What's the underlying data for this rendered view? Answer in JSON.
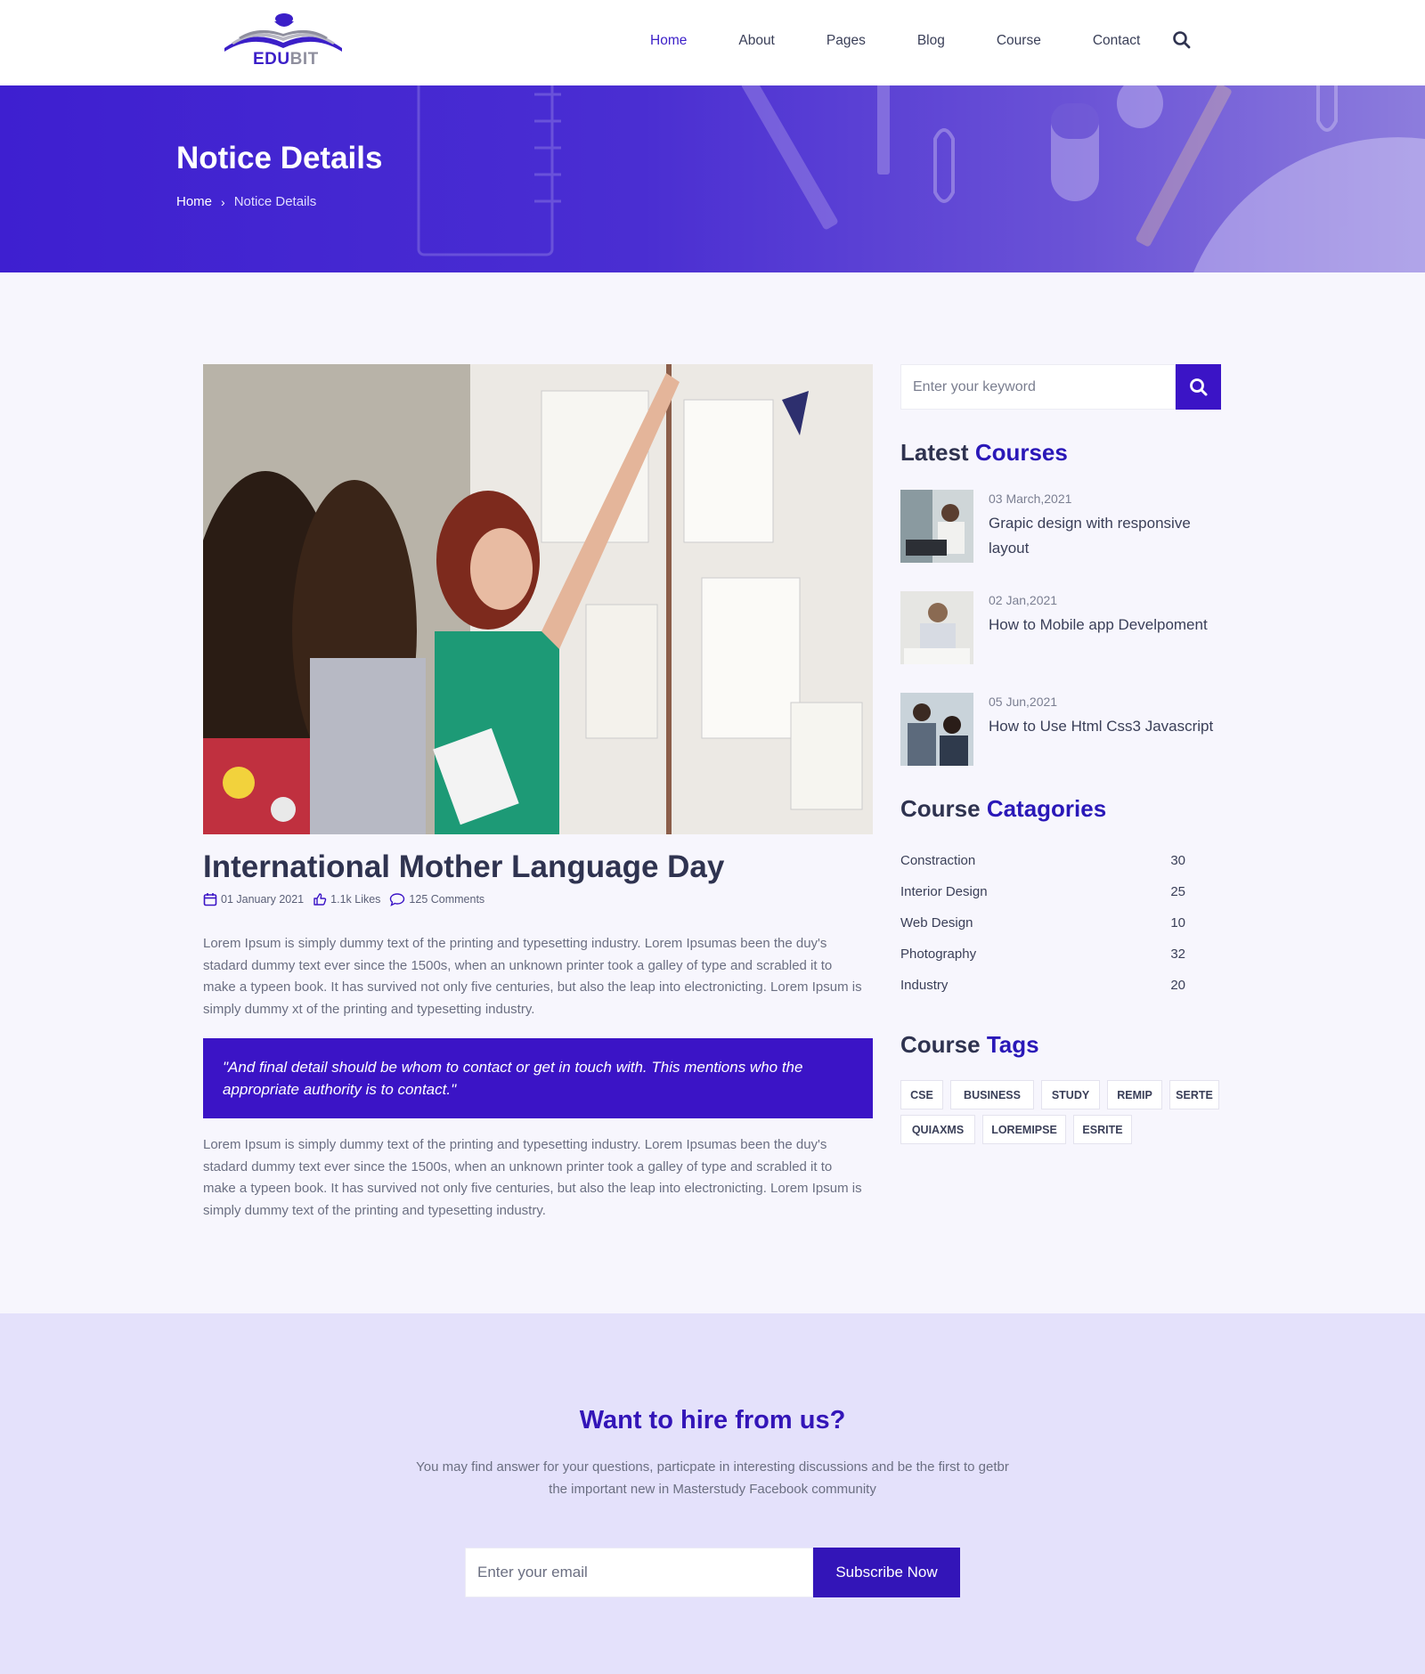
{
  "brand": {
    "logo_part1": "EDU",
    "logo_part2": "BIT"
  },
  "nav": {
    "items": [
      "Home",
      "About",
      "Pages",
      "Blog",
      "Course",
      "Contact"
    ],
    "active": "Home",
    "search_icon": "search-icon"
  },
  "banner": {
    "title": "Notice Details",
    "breadcrumb": {
      "home": "Home",
      "separator": "›",
      "current": "Notice Details"
    }
  },
  "article": {
    "title": "International Mother Language Day",
    "meta": {
      "date": "01 January 2021",
      "likes": "1.1k Likes",
      "comments": "125 Comments"
    },
    "paragraph1": "Lorem Ipsum is simply dummy text of the printing and typesetting industry. Lorem Ipsumas been the duy's stadard dummy text ever since the 1500s, when an unknown printer took a galley of type and scrabled it to make a typeen book. It has survived not only five centuries, but also the leap into electronicting. Lorem Ipsum is simply dummy xt of the printing and typesetting industry.",
    "quote": "\"And final detail should be whom to contact or get in touch with. This mentions who the appropriate authority is to contact.\"",
    "paragraph2": "Lorem Ipsum is simply dummy text of the printing and typesetting industry. Lorem Ipsumas been the duy's stadard dummy text ever since the 1500s, when an unknown printer took a galley of type and scrabled it to make a typeen book. It has survived not only five centuries, but also the leap into electronicting. Lorem Ipsum is simply dummy text of the printing and typesetting industry."
  },
  "sidebar": {
    "search_placeholder": "Enter your keyword",
    "latest_courses": {
      "heading_plain": "Latest",
      "heading_highlight": "Courses",
      "items": [
        {
          "date": "03 March,2021",
          "title": "Grapic design with responsive layout"
        },
        {
          "date": "02 Jan,2021",
          "title": "How to Mobile app Develpoment"
        },
        {
          "date": "05 Jun,2021",
          "title": "How to Use Html Css3 Javascript"
        }
      ]
    },
    "categories": {
      "heading_plain": "Course",
      "heading_highlight": "Catagories",
      "items": [
        {
          "name": "Constraction",
          "count": "30"
        },
        {
          "name": "Interior Design",
          "count": "25"
        },
        {
          "name": "Web Design",
          "count": "10"
        },
        {
          "name": "Photography",
          "count": "32"
        },
        {
          "name": "Industry",
          "count": "20"
        }
      ]
    },
    "tags": {
      "heading_plain": "Course",
      "heading_highlight": "Tags",
      "items": [
        "CSE",
        "BUSINESS",
        "STUDY",
        "REMIP",
        "SERTE",
        "QUIAXMS",
        "LOREMIPSE",
        "ESRITE"
      ]
    }
  },
  "cta": {
    "title": "Want to hire from us?",
    "text_line1": "You may find answer for your questions, particpate in interesting discussions and be the first to getbr",
    "text_line2": "the important new in Masterstudy Facebook community",
    "email_placeholder": "Enter your email",
    "button": "Subscribe Now"
  },
  "colors": {
    "primary": "#3b14c6",
    "heading": "#2f3350",
    "text": "#6b6f82",
    "page_bg": "#f7f6fd",
    "cta_bg": "#e4e1fb"
  }
}
